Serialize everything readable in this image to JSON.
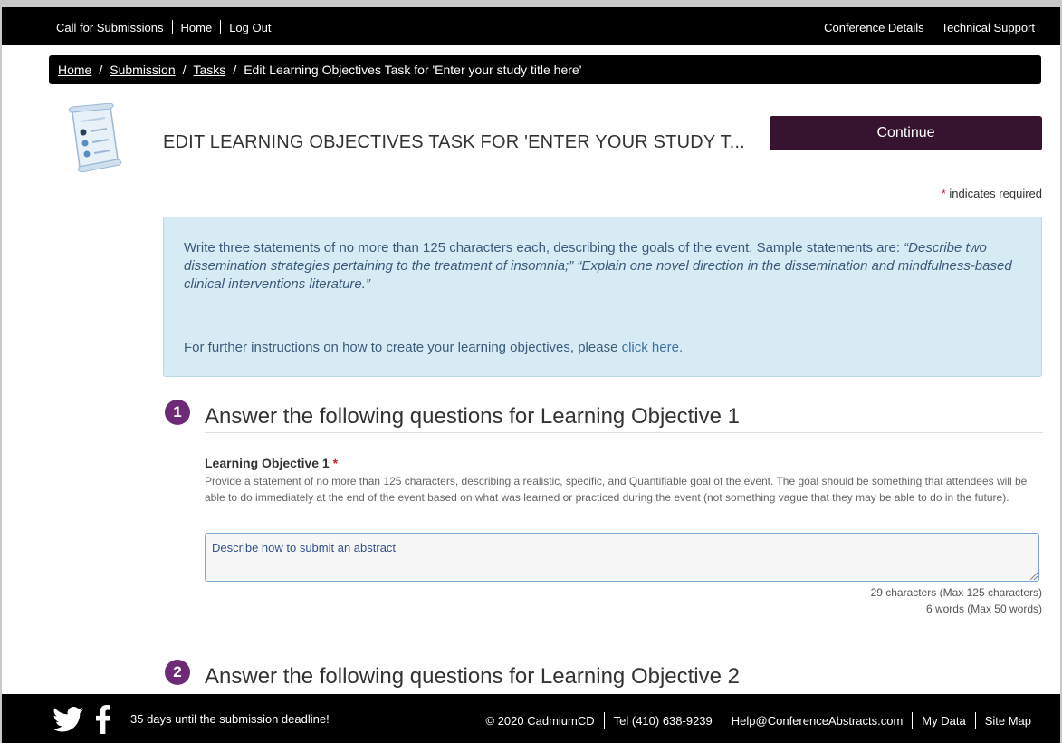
{
  "topnav": {
    "left": [
      "Call for Submissions",
      "Home",
      "Log Out"
    ],
    "right": [
      "Conference Details",
      "Technical Support"
    ]
  },
  "breadcrumb": {
    "items": [
      "Home",
      "Submission",
      "Tasks"
    ],
    "current": "Edit Learning Objectives Task for 'Enter your study title here'"
  },
  "page": {
    "icon": "checklist-scroll-icon",
    "title": "EDIT LEARNING OBJECTIVES TASK FOR 'ENTER YOUR STUDY T...",
    "continue_label": "Continue",
    "required_star": "*",
    "required_text": " indicates required"
  },
  "info": {
    "intro": "Write three statements of no more than 125 characters each, describing the goals of the event. Sample statements are:",
    "sample": "“Describe two dissemination strategies pertaining to the treatment of insomnia;” “Explain one novel direction in the dissemination and mindfulness-based clinical interventions literature.”",
    "further_prefix": "For further instructions on how to create your learning objectives, please ",
    "click_here": "click here."
  },
  "sections": [
    {
      "number": "1",
      "title": "Answer the following questions for Learning Objective 1",
      "field_label": "Learning Objective 1",
      "required_star": "*",
      "help": "Provide a statement of no more than 125 characters, describing a realistic, specific, and Quantifiable goal of the event. The goal should be something that attendees will be able to do immediately at the end of the event based on what was learned or practiced during the event (not something vague that they may be able to do in the future).",
      "value": "Describe how to submit an abstract",
      "char_count": "29 characters (Max 125 characters)",
      "word_count": "6 words (Max 50 words)"
    },
    {
      "number": "2",
      "title": "Answer the following questions for Learning Objective 2"
    }
  ],
  "footer": {
    "deadline": "35 days until the submission deadline!",
    "copyright": "© 2020 CadmiumCD",
    "phone": "Tel (410) 638-9239",
    "email": "Help@ConferenceAbstracts.com",
    "my_data": "My Data",
    "site_map": "Site Map",
    "icons": [
      "twitter-icon",
      "facebook-icon"
    ]
  },
  "colors": {
    "accent": "#6d2a75",
    "button": "#36132e",
    "info_bg": "#d7ebf4",
    "required": "#d02030"
  }
}
